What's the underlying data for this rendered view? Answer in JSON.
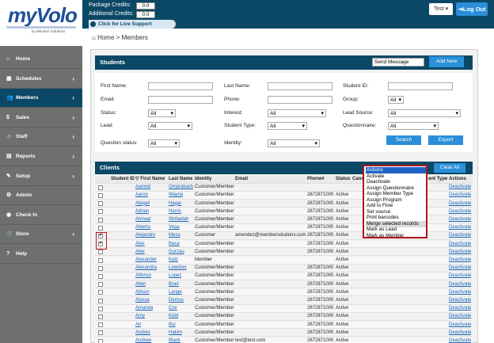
{
  "logo": {
    "brand": "myVolo",
    "sub": "by Member Solutions"
  },
  "credits": {
    "package_label": "Package Credits:",
    "package_value": "0.0",
    "additional_label": "Additional Credits:",
    "additional_value": "0.0",
    "live_support": "Click for Live Support"
  },
  "header": {
    "user_menu": "Test ▾",
    "logout": "Log Out"
  },
  "sidebar": {
    "items": [
      {
        "label": "Home",
        "icon": "home-icon",
        "glyph": "⌂",
        "chev": ""
      },
      {
        "label": "Schedules",
        "icon": "calendar-icon",
        "glyph": "▦",
        "chev": "›"
      },
      {
        "label": "Members",
        "icon": "users-icon",
        "glyph": "👥",
        "chev": "›"
      },
      {
        "label": "Sales",
        "icon": "dollar-icon",
        "glyph": "$",
        "chev": "›"
      },
      {
        "label": "Staff",
        "icon": "staff-icon",
        "glyph": "☺",
        "chev": "›"
      },
      {
        "label": "Reports",
        "icon": "chart-icon",
        "glyph": "▤",
        "chev": "›"
      },
      {
        "label": "Setup",
        "icon": "wrench-icon",
        "glyph": "✎",
        "chev": "›"
      },
      {
        "label": "Admin",
        "icon": "gear-icon",
        "glyph": "⚙",
        "chev": ""
      },
      {
        "label": "Check In",
        "icon": "checkin-icon",
        "glyph": "◉",
        "chev": ""
      },
      {
        "label": "Store",
        "icon": "cart-icon",
        "glyph": "🛒",
        "chev": "›"
      },
      {
        "label": "Help",
        "icon": "help-icon",
        "glyph": "?",
        "chev": ""
      }
    ],
    "active_index": 2
  },
  "breadcrumb": {
    "home": "Home",
    "sep": ">",
    "current": "Members"
  },
  "students": {
    "title": "Students",
    "send_message": "Send Message",
    "add_new": "Add New"
  },
  "filters": {
    "first_name": "First Name:",
    "last_name": "Last Name:",
    "student_id": "Student ID:",
    "email": "Email:",
    "phone": "Phone:",
    "group": "Group:",
    "group_value": "All",
    "status": "Status:",
    "status_value": "All",
    "interest": "Interest:",
    "interest_value": "All",
    "lead_source": "Lead Source:",
    "lead_source_value": "All",
    "lead": "Lead:",
    "lead_value": "All",
    "student_type": "Student Type:",
    "student_type_value": "All",
    "questionnaire": "Questionnaire:",
    "questionnaire_value": "All",
    "question_status": "Question status:",
    "question_status_value": "All",
    "identity": "Identity:",
    "identity_value": "All",
    "search": "Search",
    "export": "Export"
  },
  "clients": {
    "title": "Clients",
    "clear_all": "Clear All"
  },
  "table": {
    "headers": {
      "student_id": "Student ID",
      "first_name": "▽ First Name",
      "last_name": "Last Name",
      "identity": "Identity",
      "email": "Email",
      "phone": "Phone#",
      "status": "Status",
      "canc": "Canc",
      "type": "ent Type",
      "actions": "Actions"
    },
    "rows": [
      {
        "first": "Aamod",
        "last": "Omprakash",
        "identity": "Customer/Member",
        "email": "",
        "phone": "",
        "status": "",
        "checked": false
      },
      {
        "first": "Aaron",
        "last": "Wayne",
        "identity": "Customer/Member",
        "email": "",
        "phone": "2672871000",
        "status": "Active",
        "checked": false
      },
      {
        "first": "Abigail",
        "last": "Hagar",
        "identity": "Customer/Member",
        "email": "",
        "phone": "2672871000",
        "status": "Active",
        "checked": false
      },
      {
        "first": "Adrian",
        "last": "Harris",
        "identity": "Customer/Member",
        "email": "",
        "phone": "2672871000",
        "status": "Active",
        "checked": false
      },
      {
        "first": "Ahmad",
        "last": "Shihadah",
        "identity": "Customer/Member",
        "email": "",
        "phone": "2672871000",
        "status": "Active",
        "checked": false
      },
      {
        "first": "Alberto",
        "last": "Vega",
        "identity": "Customer/Member",
        "email": "",
        "phone": "2672871000",
        "status": "Active",
        "checked": false
      },
      {
        "first": "Alejandro",
        "last": "Meza",
        "identity": "Customer",
        "email": "amendez@membersolutions.com",
        "phone": "2672871000",
        "status": "Active",
        "checked": true
      },
      {
        "first": "Alex",
        "last": "Baca",
        "identity": "Customer/Member",
        "email": "",
        "phone": "2672871000",
        "status": "Active",
        "checked": true
      },
      {
        "first": "Alex",
        "last": "Gurzau",
        "identity": "Customer/Member",
        "email": "",
        "phone": "2672871000",
        "status": "Active",
        "checked": false
      },
      {
        "first": "Alexander",
        "last": "Katz",
        "identity": "Member",
        "email": "",
        "phone": "",
        "status": "Active",
        "checked": false
      },
      {
        "first": "Alexandra",
        "last": "Lowcher",
        "identity": "Customer/Member",
        "email": "",
        "phone": "2672871000",
        "status": "Active",
        "checked": false
      },
      {
        "first": "Alfonso",
        "last": "Lopez",
        "identity": "Customer/Member",
        "email": "",
        "phone": "2672871000",
        "status": "Active",
        "checked": false
      },
      {
        "first": "Allen",
        "last": "Brad",
        "identity": "Customer/Member",
        "email": "",
        "phone": "2672871000",
        "status": "Active",
        "checked": false
      },
      {
        "first": "Allison",
        "last": "Lange",
        "identity": "Customer/Member",
        "email": "",
        "phone": "2672871000",
        "status": "Active",
        "checked": false
      },
      {
        "first": "Alyssa",
        "last": "Demus",
        "identity": "Customer/Member",
        "email": "",
        "phone": "2672871000",
        "status": "Active",
        "checked": false
      },
      {
        "first": "Amanda",
        "last": "Cox",
        "identity": "Customer/Member",
        "email": "",
        "phone": "2672871000",
        "status": "Active",
        "checked": false
      },
      {
        "first": "Amy",
        "last": "Kidd",
        "identity": "Customer/Member",
        "email": "",
        "phone": "2672871000",
        "status": "Active",
        "checked": false
      },
      {
        "first": "An",
        "last": "Bui",
        "identity": "Customer/Member",
        "email": "",
        "phone": "2672871000",
        "status": "Active",
        "checked": false
      },
      {
        "first": "Andres",
        "last": "Hakim",
        "identity": "Customer/Member",
        "email": "",
        "phone": "2672871000",
        "status": "Active",
        "checked": false
      },
      {
        "first": "Andrew",
        "last": "Black",
        "identity": "Customer/Member",
        "email": "test@test.com",
        "phone": "2672871000",
        "status": "Active",
        "checked": false
      }
    ],
    "action_link": "Deactivate"
  },
  "actions_menu": {
    "items": [
      "Actions",
      "Activate",
      "Deactivate",
      "Assign Questionnaire",
      "Assign Member Type",
      "Assign Program",
      "Add to Flow",
      "Set source",
      "Print barcodes",
      "Merge selected records",
      "Mark as Lead",
      "Mark as Member"
    ],
    "selected_index": 0,
    "hover_index": 9
  },
  "colors": {
    "brand_dark": "#0b4865",
    "button_blue": "#2a8fd8",
    "highlight_red": "#c0141c"
  }
}
